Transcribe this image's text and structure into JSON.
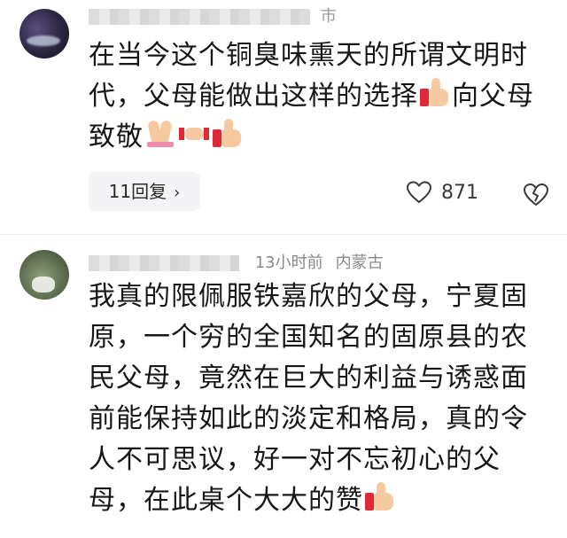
{
  "comments": [
    {
      "author_meta": "市",
      "lines": [
        "在当今这个铜臭味熏天的所谓文明时",
        "代，父母能做出这样的选择",
        "向父母",
        "致敬"
      ],
      "reply_label": "11回复",
      "reply_chevron": "›",
      "like_count": "871"
    },
    {
      "author_time": "13小时前",
      "author_location": "内蒙古",
      "lines": [
        "我真的限佩服铁嘉欣的父母，宁夏固",
        "原，一个穷的全国知名的固原县的农",
        "民父母，竟然在巨大的利益与诱惑面",
        "前能保持如此的淡定和格局，真的令",
        "人不可思议，好一对不忘初心的父",
        "母，在此桌个大大的赞"
      ]
    }
  ],
  "icons": {
    "like": "heart-outline-icon",
    "dislike": "broken-heart-icon",
    "thumbs_up": "thumbs-up-emoji",
    "pray": "folded-hands-emoji",
    "handshake": "handshake-emoji"
  }
}
